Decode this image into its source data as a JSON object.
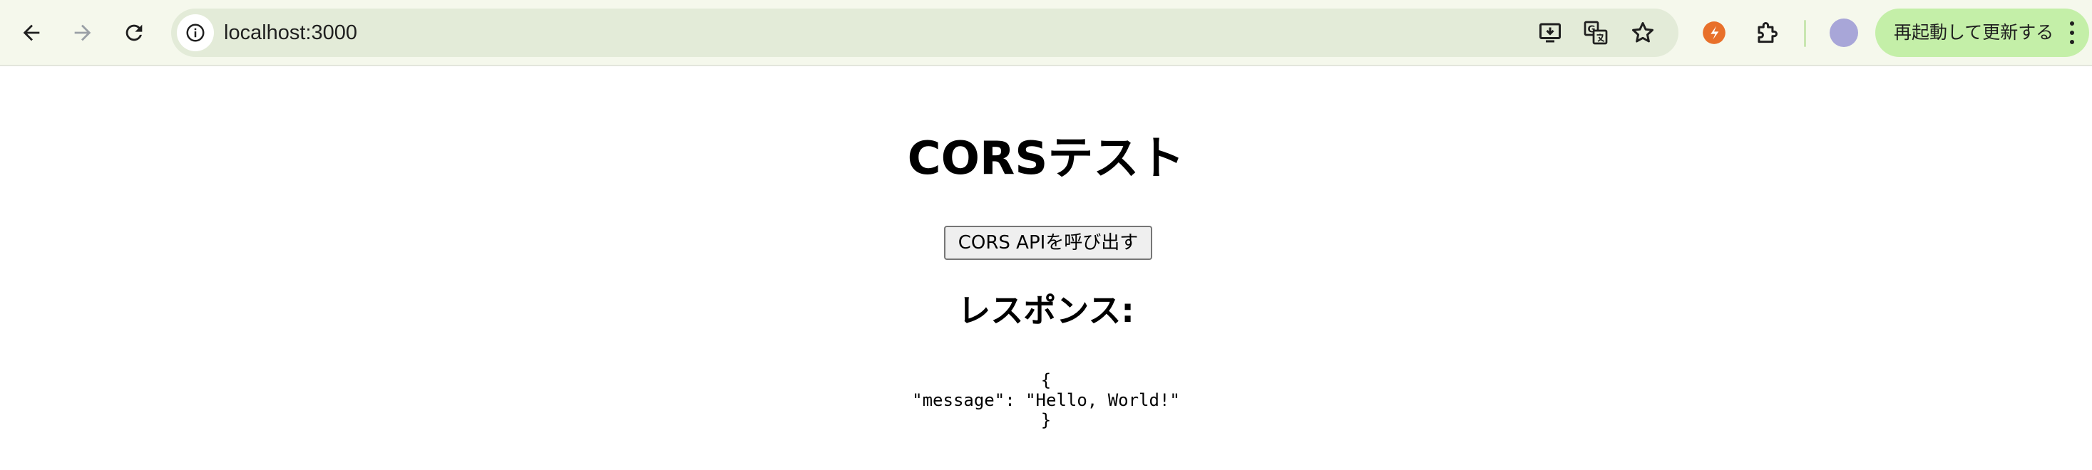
{
  "browser": {
    "url": "localhost:3000",
    "update_button_label": "再起動して更新する",
    "colors": {
      "toolbar_bg": "#f5f8ec",
      "omnibox_bg": "#e3ebd8",
      "update_bg": "#c4efa8",
      "extension_accent": "#e8702a",
      "avatar": "#a8a6d8"
    },
    "icons": [
      "back-arrow-icon",
      "forward-arrow-icon",
      "reload-icon",
      "site-info-icon",
      "install-app-icon",
      "translate-icon",
      "bookmark-star-icon",
      "extension-icon",
      "puzzle-extensions-icon",
      "more-menu-icon"
    ]
  },
  "page": {
    "title": "CORSテスト",
    "call_button_label": "CORS APIを呼び出す",
    "response_heading": "レスポンス:",
    "response_lines": [
      "{",
      "\"message\": \"Hello, World!\"",
      "}"
    ]
  }
}
